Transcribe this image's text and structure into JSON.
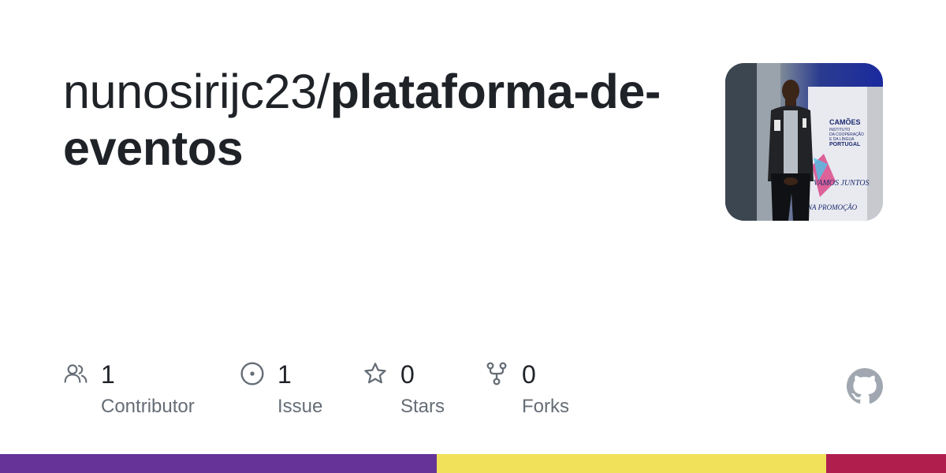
{
  "repo": {
    "owner": "nunosirijc23/",
    "name": "plataforma-de-eventos"
  },
  "stats": [
    {
      "icon": "people-icon",
      "count": "1",
      "label": "Contributor"
    },
    {
      "icon": "issue-icon",
      "count": "1",
      "label": "Issue"
    },
    {
      "icon": "star-icon",
      "count": "0",
      "label": "Stars"
    },
    {
      "icon": "fork-icon",
      "count": "0",
      "label": "Forks"
    }
  ],
  "avatar": {
    "banner_line1": "CAMÕES",
    "banner_line2": "INSTITUTO",
    "banner_line3": "DA COOPERAÇÃO",
    "banner_line4": "E DA LÍNGUA",
    "banner_line5": "PORTUGAL",
    "banner_line6": "VAMOS JUNTOS",
    "banner_line7": "NA PROMOÇÃO"
  },
  "colors": {
    "language_bar": [
      {
        "color": "#663399",
        "share": 0.462
      },
      {
        "color": "#f1e05a",
        "share": 0.411
      },
      {
        "color": "#b01e4e",
        "share": 0.127
      }
    ]
  }
}
